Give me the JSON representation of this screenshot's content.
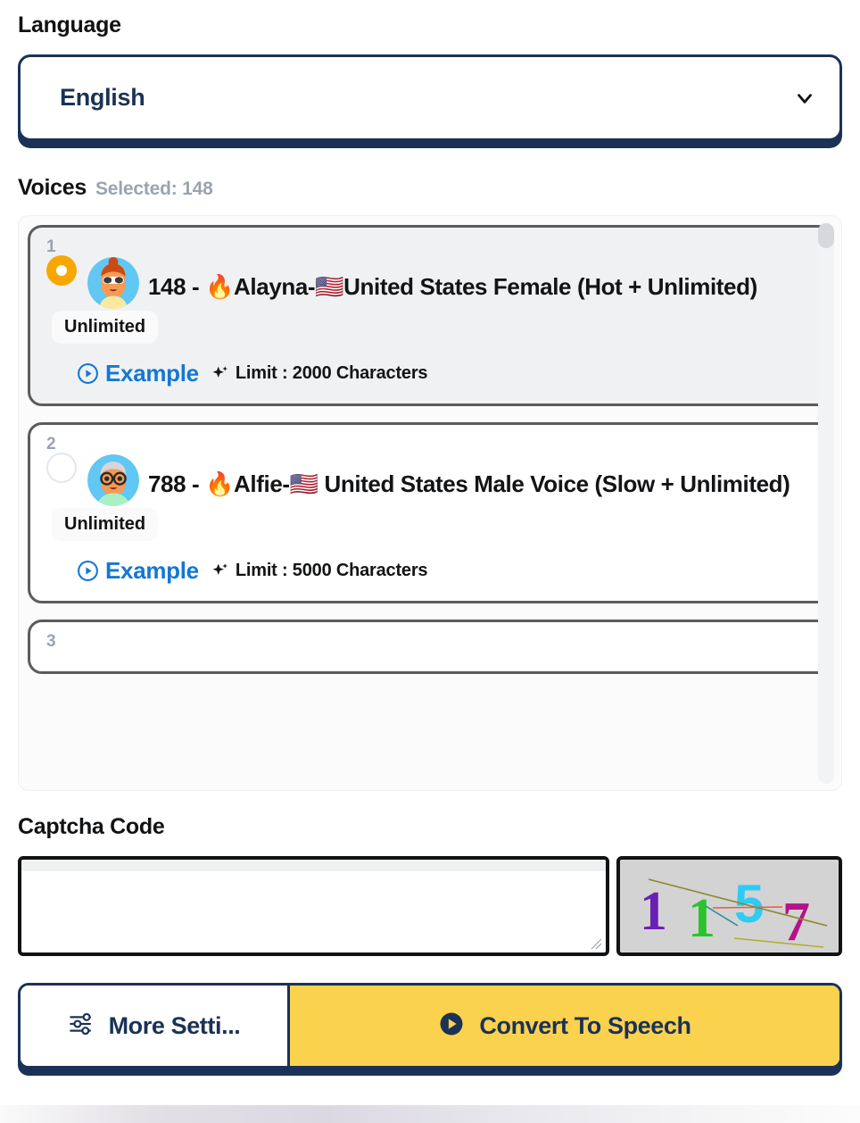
{
  "language": {
    "label": "Language",
    "selected": "English",
    "chevron_icon": "chevron-down-icon"
  },
  "voices": {
    "label": "Voices",
    "selected_text": "Selected: 148",
    "items": [
      {
        "index": "1",
        "selected": true,
        "avatar_icon": "avatar-female-sunglasses",
        "title": "148 - 🔥Alayna-🇺🇸United States Female (Hot + Unlimited)",
        "badge": "Unlimited",
        "example_label": "Example",
        "sparkle_icon": "sparkle-icon",
        "limit_text": "Limit : 2000 Characters"
      },
      {
        "index": "2",
        "selected": false,
        "avatar_icon": "avatar-elder-male-glasses",
        "title": "788 - 🔥Alfie-🇺🇸 United States Male Voice (Slow + Unlimited)",
        "badge": "Unlimited",
        "example_label": "Example",
        "sparkle_icon": "sparkle-icon",
        "limit_text": "Limit : 5000 Characters"
      },
      {
        "index": "3",
        "selected": false,
        "avatar_icon": "",
        "title": "",
        "badge": "",
        "example_label": "",
        "sparkle_icon": "",
        "limit_text": ""
      }
    ]
  },
  "captcha": {
    "label": "Captcha Code",
    "input_value": "",
    "input_placeholder": "",
    "code": "1157",
    "digits": [
      {
        "char": "1",
        "color": "#6a1fb5"
      },
      {
        "char": "1",
        "color": "#2bc32b"
      },
      {
        "char": "5",
        "color": "#2ecbf5"
      },
      {
        "char": "7",
        "color": "#b5128a"
      }
    ]
  },
  "actions": {
    "more_settings_label": "More Setti...",
    "more_settings_icon": "sliders-icon",
    "convert_label": "Convert To Speech",
    "convert_icon": "play-circle-filled-icon"
  },
  "colors": {
    "navy": "#1b3256",
    "yellow": "#fbd24e",
    "amber": "#f7a800",
    "link_blue": "#1477d4"
  }
}
